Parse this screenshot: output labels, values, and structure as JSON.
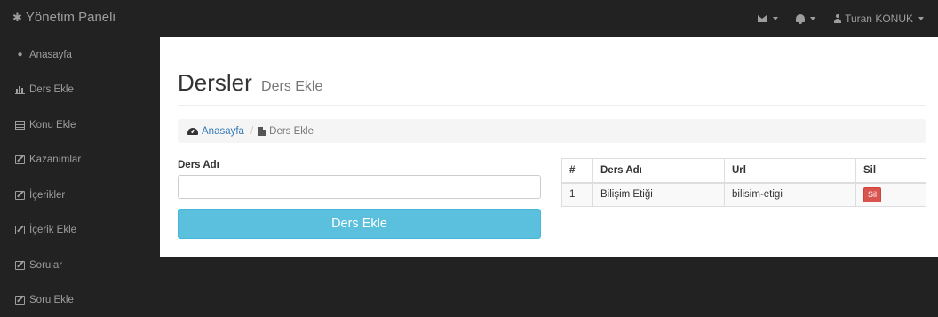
{
  "navbar": {
    "brand": "Yönetim Paneli",
    "user_name": "Turan KONUK"
  },
  "sidebar": {
    "items": [
      {
        "label": "Anasayfa",
        "icon": "dashboard-icon"
      },
      {
        "label": "Ders Ekle",
        "icon": "bar-chart-icon"
      },
      {
        "label": "Konu Ekle",
        "icon": "table-icon"
      },
      {
        "label": "Kazanımlar",
        "icon": "edit-icon"
      },
      {
        "label": "İçerikler",
        "icon": "edit-icon"
      },
      {
        "label": "İçerik Ekle",
        "icon": "edit-icon"
      },
      {
        "label": "Sorular",
        "icon": "edit-icon"
      },
      {
        "label": "Soru Ekle",
        "icon": "edit-icon"
      }
    ]
  },
  "page": {
    "title": "Dersler",
    "subtitle": "Ders Ekle"
  },
  "breadcrumb": {
    "home": "Anasayfa",
    "current": "Ders Ekle"
  },
  "form": {
    "label": "Ders Adı",
    "value": "",
    "placeholder": "",
    "submit_label": "Ders Ekle"
  },
  "table": {
    "headers": [
      "#",
      "Ders Adı",
      "Url",
      "Sil"
    ],
    "rows": [
      {
        "num": "1",
        "name": "Bilişim Etiği",
        "url": "bilisim-etigi",
        "delete_label": "Sil"
      }
    ]
  },
  "colors": {
    "navbar_bg": "#222222",
    "primary_link": "#337ab7",
    "info_button": "#5bc0de",
    "danger_button": "#d9534f"
  }
}
